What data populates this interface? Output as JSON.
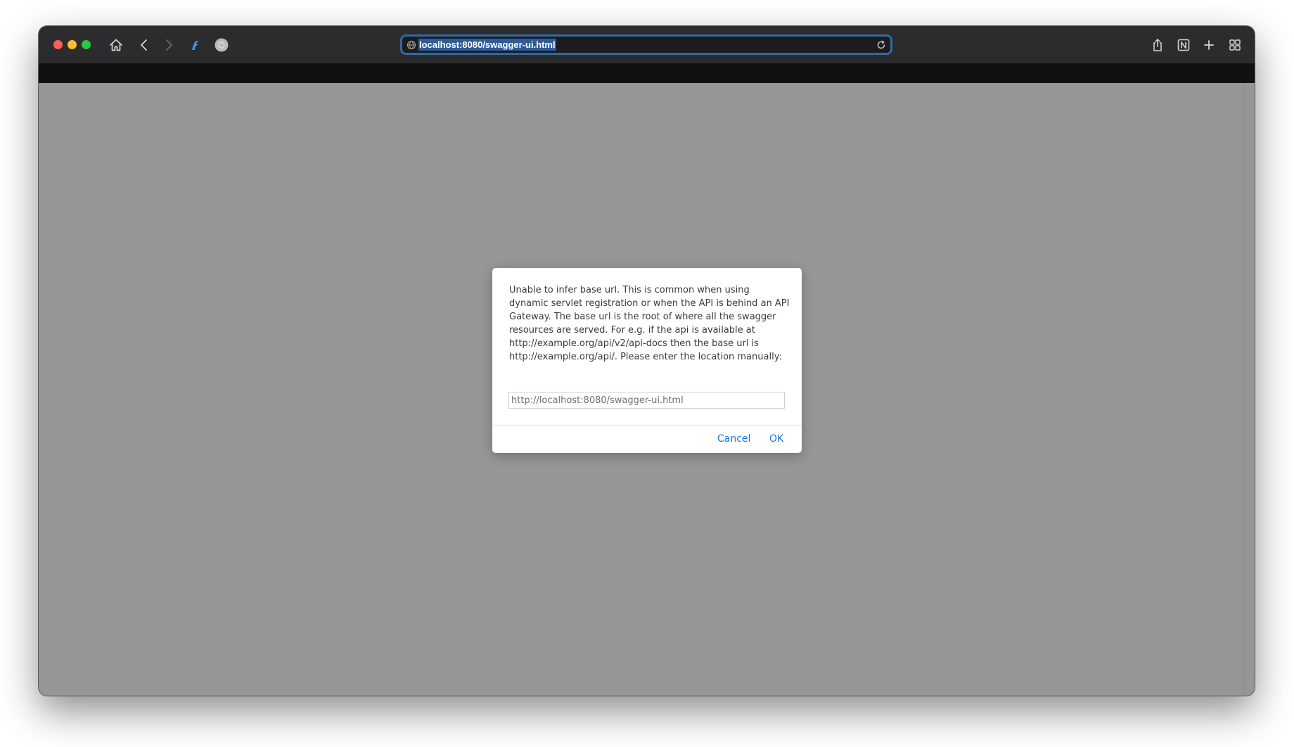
{
  "browser": {
    "address_bar": {
      "url": "localhost:8080/swagger-ui.html"
    },
    "toolbar_icons": [
      "home-icon",
      "back-icon",
      "forward-icon",
      "extension-icon",
      "profile-icon",
      "share-icon",
      "notion-icon",
      "new-tab-icon",
      "tab-overview-icon"
    ],
    "colors": {
      "titlebar": "#2c2c2e",
      "address_focus_ring": "#2f6aa3",
      "page_overlay": "#969696"
    }
  },
  "dialog": {
    "message": "Unable to infer base url. This is common when using dynamic servlet registration or when the API is behind an API Gateway. The base url is the root of where all the swagger resources are served. For e.g. if the api is available at http://example.org/api/v2/api-docs then the base url is http://example.org/api/. Please enter the location manually:",
    "input_value": "http://localhost:8080/swagger-ui.html",
    "cancel_label": "Cancel",
    "ok_label": "OK",
    "link_color": "#1a73e8"
  }
}
